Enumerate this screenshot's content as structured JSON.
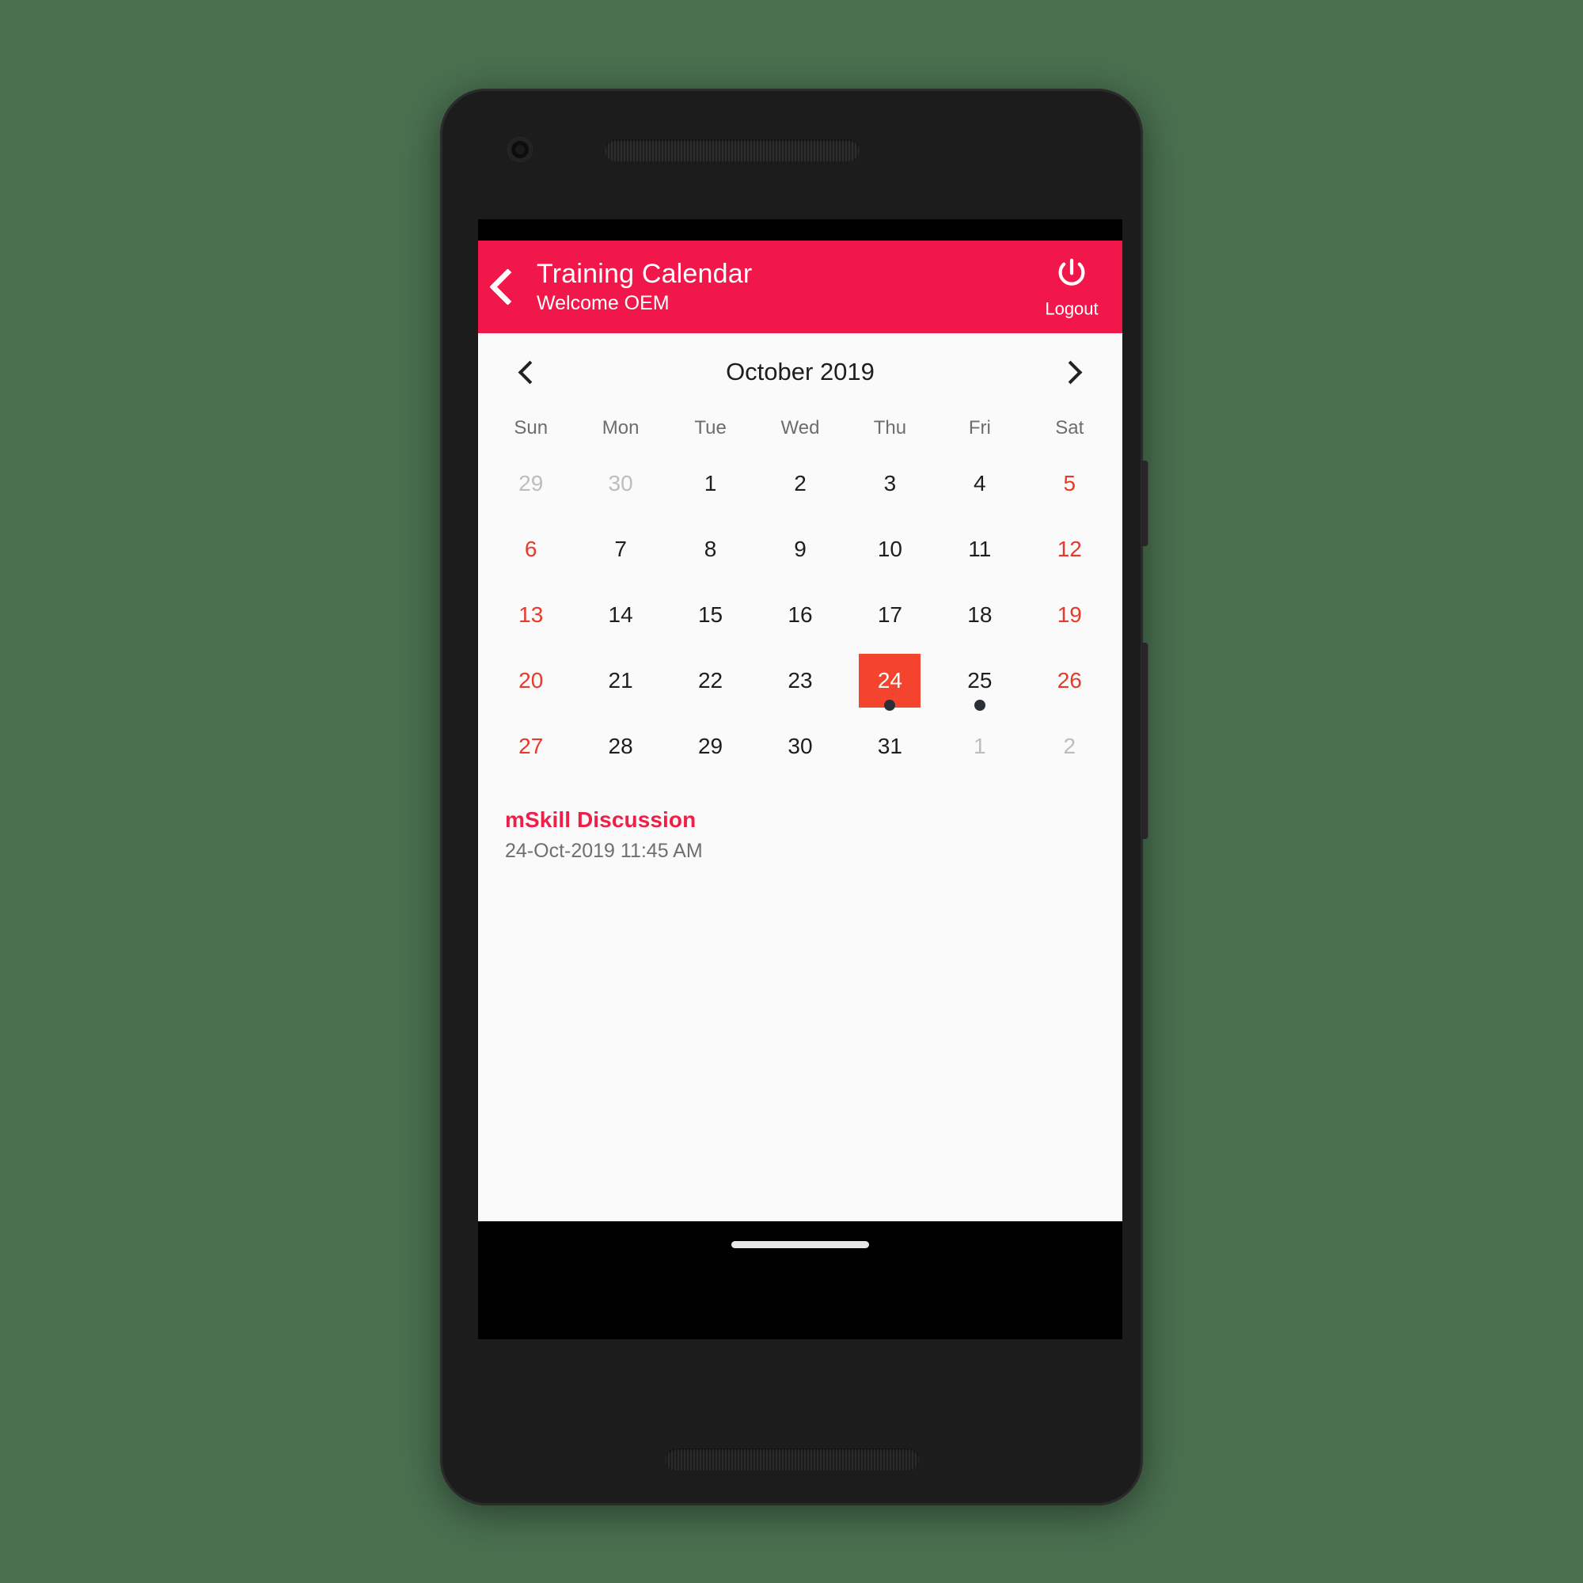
{
  "colors": {
    "brand_red": "#f2174b",
    "selection_red": "#f4442e",
    "event_title_red": "#ee2048",
    "weekend_red": "#e8392b",
    "background_green": "#4a7050"
  },
  "header": {
    "back_icon": "chevron-left-icon",
    "title": "Training Calendar",
    "subtitle": "Welcome OEM",
    "logout_icon": "power-icon",
    "logout_label": "Logout"
  },
  "calendar": {
    "prev_icon": "chevron-left-icon",
    "next_icon": "chevron-right-icon",
    "month_label": "October 2019",
    "weekdays": [
      "Sun",
      "Mon",
      "Tue",
      "Wed",
      "Thu",
      "Fri",
      "Sat"
    ],
    "days": [
      {
        "n": "29",
        "type": "other"
      },
      {
        "n": "30",
        "type": "other"
      },
      {
        "n": "1",
        "type": "day"
      },
      {
        "n": "2",
        "type": "day"
      },
      {
        "n": "3",
        "type": "day"
      },
      {
        "n": "4",
        "type": "day"
      },
      {
        "n": "5",
        "type": "weekend"
      },
      {
        "n": "6",
        "type": "weekend"
      },
      {
        "n": "7",
        "type": "day"
      },
      {
        "n": "8",
        "type": "day"
      },
      {
        "n": "9",
        "type": "day"
      },
      {
        "n": "10",
        "type": "day"
      },
      {
        "n": "11",
        "type": "day"
      },
      {
        "n": "12",
        "type": "weekend"
      },
      {
        "n": "13",
        "type": "weekend"
      },
      {
        "n": "14",
        "type": "day"
      },
      {
        "n": "15",
        "type": "day"
      },
      {
        "n": "16",
        "type": "day"
      },
      {
        "n": "17",
        "type": "day"
      },
      {
        "n": "18",
        "type": "day"
      },
      {
        "n": "19",
        "type": "weekend"
      },
      {
        "n": "20",
        "type": "weekend"
      },
      {
        "n": "21",
        "type": "day"
      },
      {
        "n": "22",
        "type": "day"
      },
      {
        "n": "23",
        "type": "day"
      },
      {
        "n": "24",
        "type": "day",
        "selected": true,
        "dot": true
      },
      {
        "n": "25",
        "type": "day",
        "dot": true
      },
      {
        "n": "26",
        "type": "weekend"
      },
      {
        "n": "27",
        "type": "weekend"
      },
      {
        "n": "28",
        "type": "day"
      },
      {
        "n": "29",
        "type": "day"
      },
      {
        "n": "30",
        "type": "day"
      },
      {
        "n": "31",
        "type": "day"
      },
      {
        "n": "1",
        "type": "other"
      },
      {
        "n": "2",
        "type": "other"
      }
    ]
  },
  "events": [
    {
      "title": "mSkill Discussion",
      "time": "24-Oct-2019 11:45 AM"
    }
  ],
  "device": {
    "camera_icon": "front-camera-icon",
    "earpiece_icon": "earpiece-speaker-icon",
    "bottom_speaker_icon": "bottom-speaker-icon",
    "power_button_icon": "power-side-button",
    "volume_button_icon": "volume-side-button",
    "gesture_pill_icon": "home-gesture-pill"
  }
}
